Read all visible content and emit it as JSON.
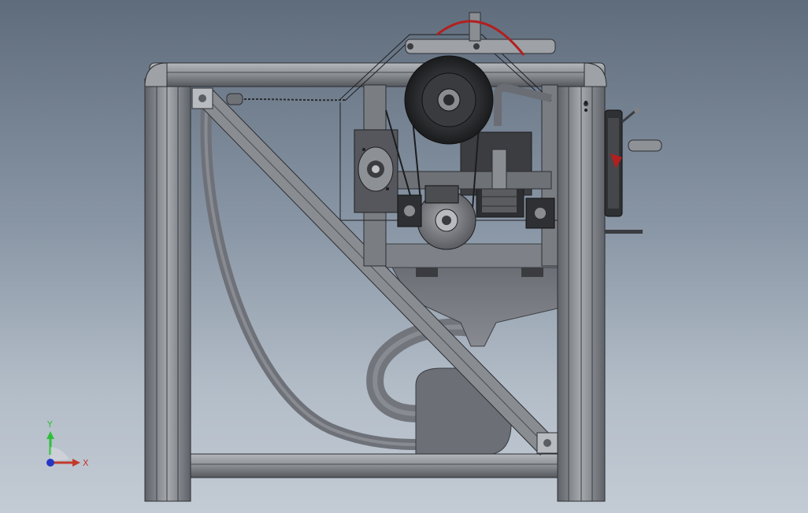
{
  "triad": {
    "y_label": "Y",
    "x_label": "X",
    "y_color": "#2fbf3a",
    "x_color": "#c23a2c",
    "z_color": "#2636c4"
  },
  "palette": {
    "frame": "#8e9196",
    "frame_dark": "#3a3d42",
    "part": "#6f7278",
    "hose": "#7b7e86",
    "wheel_red": "#b21f1f"
  },
  "icons": [
    "coordinate-triad-icon"
  ]
}
